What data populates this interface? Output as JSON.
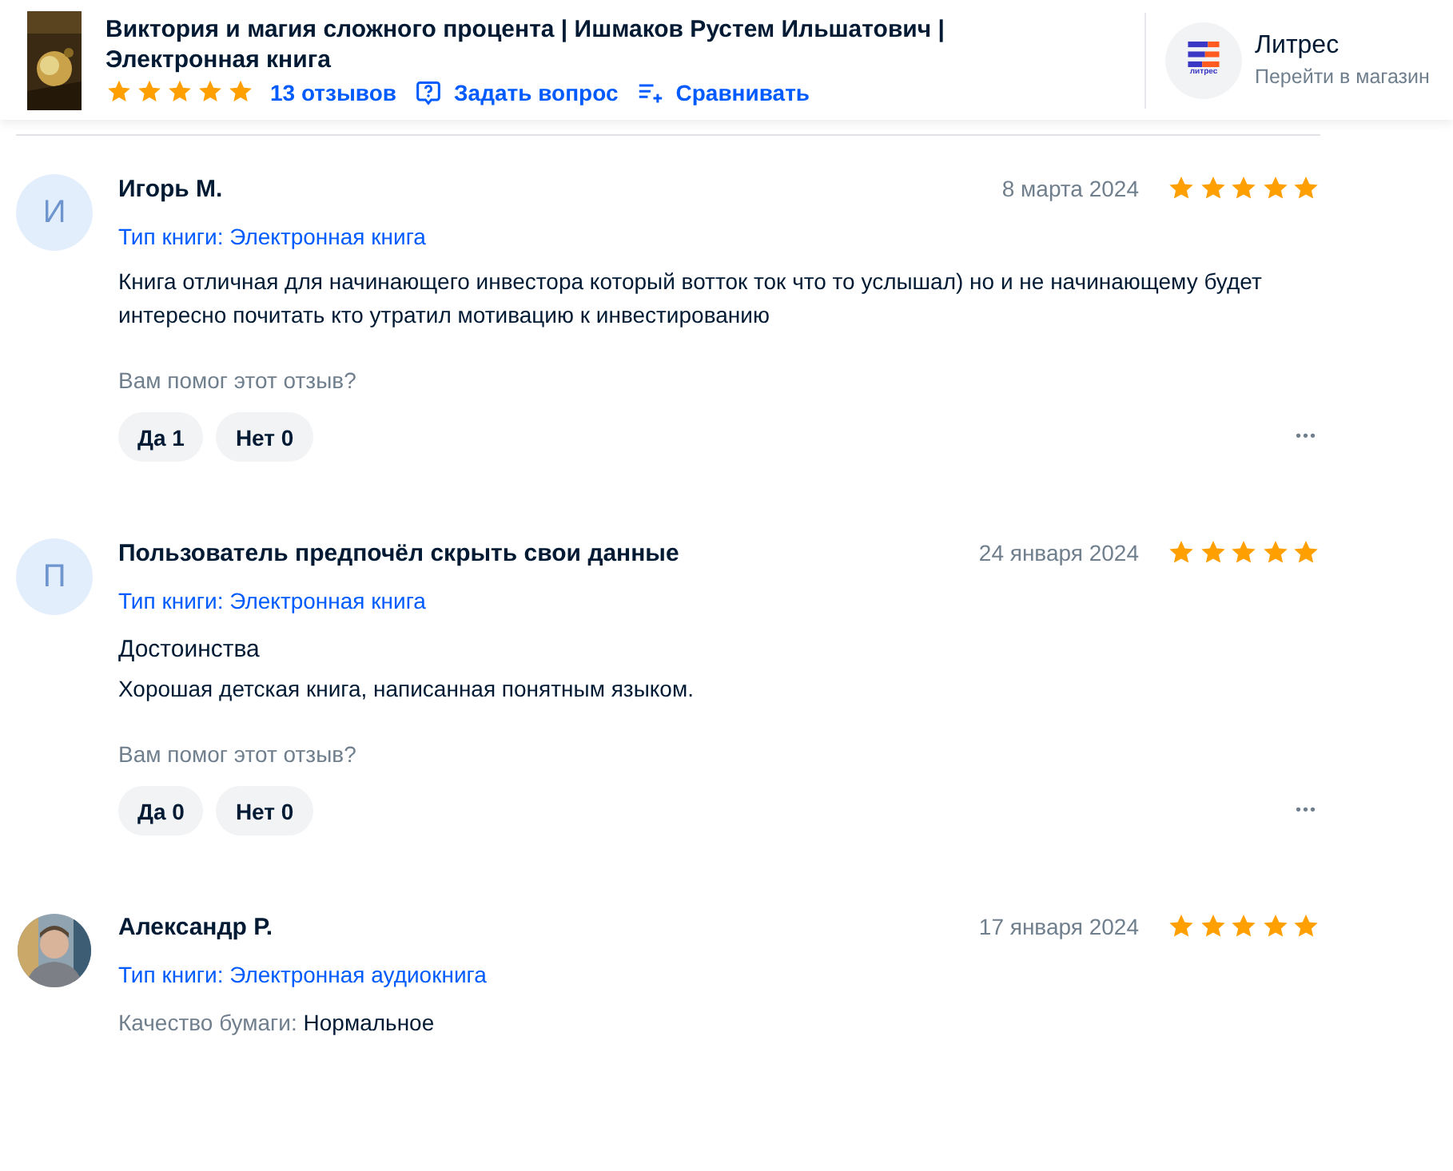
{
  "product": {
    "title": "Виктория и магия сложного процента | Ишмаков Рустем Ильшатович | Электронная книга",
    "stars": 5,
    "reviews_link": "13 отзывов",
    "ask_link": "Задать вопрос",
    "compare_link": "Сравнивать"
  },
  "store": {
    "name": "Литрес",
    "logo_text": "литрес",
    "link": "Перейти в магазин"
  },
  "reviews": [
    {
      "avatar": {
        "kind": "letter",
        "letter": "И"
      },
      "author": "Игорь М.",
      "date": "8 марта 2024",
      "stars": 5,
      "book_type": "Тип книги: Электронная книга",
      "text": "Книга отличная для начинающего инвестора который вотток ток что то услышал) но и не начинающему будет интересно почитать кто утратил мотивацию к инвестированию",
      "helpful_prompt": "Вам помог этот отзыв?",
      "yes": "Да 1",
      "no": "Нет 0",
      "more": "•••"
    },
    {
      "avatar": {
        "kind": "letter",
        "letter": "П"
      },
      "author": "Пользователь предпочёл скрыть свои данные",
      "date": "24 января 2024",
      "stars": 5,
      "book_type": "Тип книги: Электронная книга",
      "heading": "Достоинства",
      "text": "Хорошая детская книга, написанная понятным языком.",
      "helpful_prompt": "Вам помог этот отзыв?",
      "yes": "Да 0",
      "no": "Нет 0",
      "more": "•••"
    },
    {
      "author": "Александр Р.",
      "date": "17 января 2024",
      "stars": 5,
      "book_type": "Тип книги: Электронная аудиокнига",
      "details": [
        {
          "label": "Качество бумаги:",
          "value": "Нормальное"
        }
      ]
    }
  ]
}
